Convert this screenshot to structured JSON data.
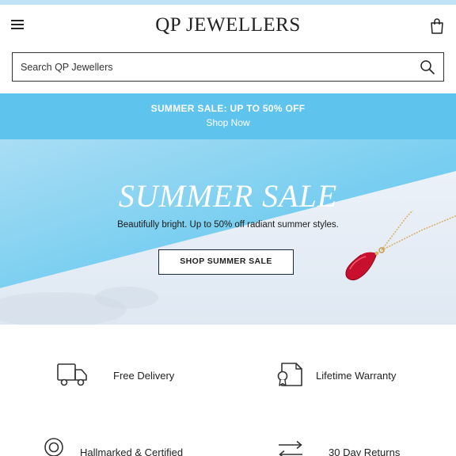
{
  "header": {
    "logo": "QP JEWELLERS",
    "icons": {
      "menu": "hamburger-menu-icon",
      "bag": "shopping-bag-icon"
    }
  },
  "search": {
    "placeholder": "Search QP Jewellers",
    "icon": "search-icon"
  },
  "promo_banner": {
    "title": "SUMMER SALE: UP TO 50% OFF",
    "link": "Shop Now",
    "color": "#5ec3ed"
  },
  "hero": {
    "title": "SUMMER SALE",
    "subtitle": "Beautifully bright. Up to 50% off radiant summer styles.",
    "cta": "SHOP SUMMER SALE",
    "colors": {
      "sky": "#7fd0f0",
      "gem": "#c8102e",
      "gold": "#d9b36a"
    }
  },
  "features": [
    {
      "label": "Free Delivery",
      "icon": "delivery-truck-icon"
    },
    {
      "label": "Lifetime Warranty",
      "icon": "warranty-certificate-icon"
    },
    {
      "label": "Hallmarked & Certified",
      "icon": "hallmark-seal-icon"
    },
    {
      "label": "30 Day Returns",
      "icon": "returns-arrows-icon"
    }
  ]
}
